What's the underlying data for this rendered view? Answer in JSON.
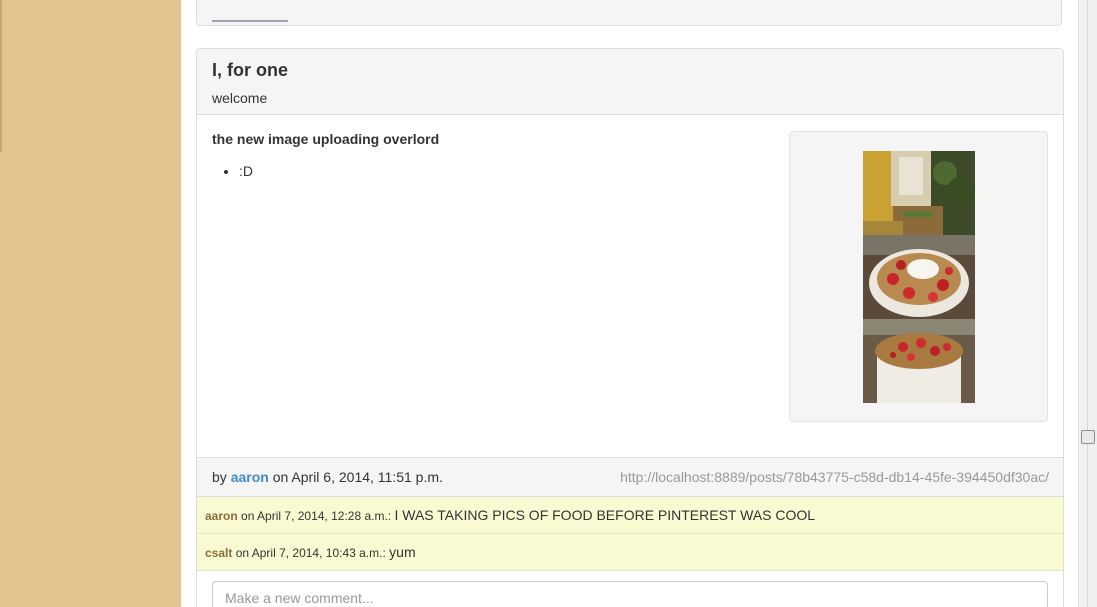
{
  "post": {
    "title": "I, for one",
    "subtitle": "welcome",
    "body_title": "the new image uploading overlord",
    "list_items": [
      ":D"
    ],
    "images": [
      {
        "name": "hallway-photo"
      },
      {
        "name": "yogurt-strawberries-photo"
      },
      {
        "name": "yogurt-granola-photo"
      }
    ],
    "footer": {
      "by_label": "by",
      "author": "aaron",
      "on_label": "on",
      "date": "April 6, 2014, 11:51 p.m.",
      "permalink": "http://localhost:8889/posts/78b43775-c58d-db14-45fe-394450df30ac/"
    }
  },
  "comments": [
    {
      "author": "aaron",
      "meta": "on April 7, 2014, 12:28 a.m.:",
      "text": "I WAS TAKING PICS OF FOOD BEFORE PINTEREST WAS COOL"
    },
    {
      "author": "csalt",
      "meta": "on April 7, 2014, 10:43 a.m.:",
      "text": "yum"
    }
  ],
  "new_comment": {
    "placeholder": "Make a new comment..."
  },
  "colors": {
    "sidebar": "#e4c590",
    "panel_heading": "#f5f5f5",
    "comment_bg": "#fafad2",
    "author_link": "#428bca",
    "comment_author": "#8a6d3b"
  }
}
